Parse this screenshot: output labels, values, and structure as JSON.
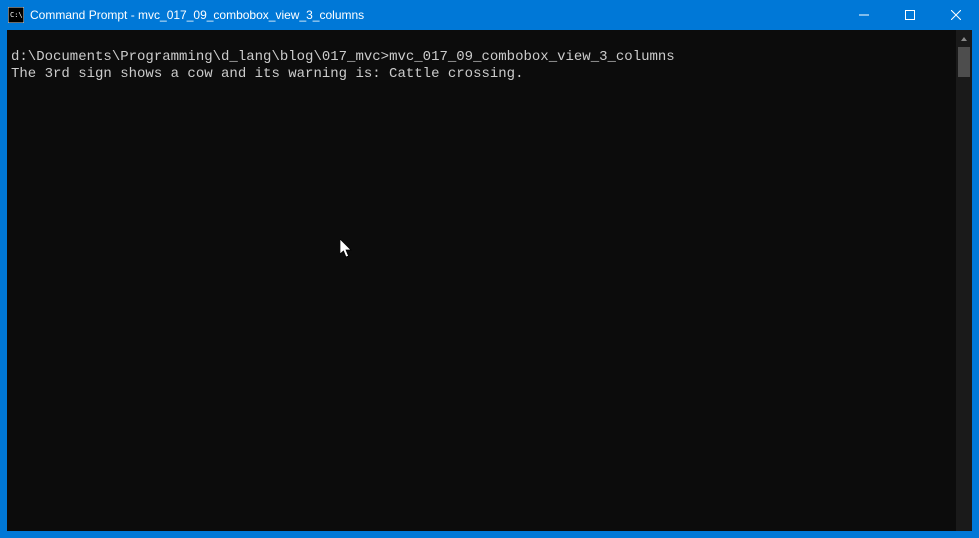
{
  "titlebar": {
    "title": "Command Prompt - mvc_017_09_combobox_view_3_columns",
    "icon_name": "cmd-icon"
  },
  "window_controls": {
    "minimize_name": "minimize-button",
    "maximize_name": "maximize-button",
    "close_name": "close-button"
  },
  "console": {
    "prompt_path": "d:\\Documents\\Programming\\d_lang\\blog\\017_mvc>",
    "command": "mvc_017_09_combobox_view_3_columns",
    "output_line": "The 3rd sign shows a cow and its warning is: Cattle crossing."
  },
  "colors": {
    "titlebar_bg": "#0078d7",
    "console_bg": "#0c0c0c",
    "console_fg": "#cccccc"
  }
}
